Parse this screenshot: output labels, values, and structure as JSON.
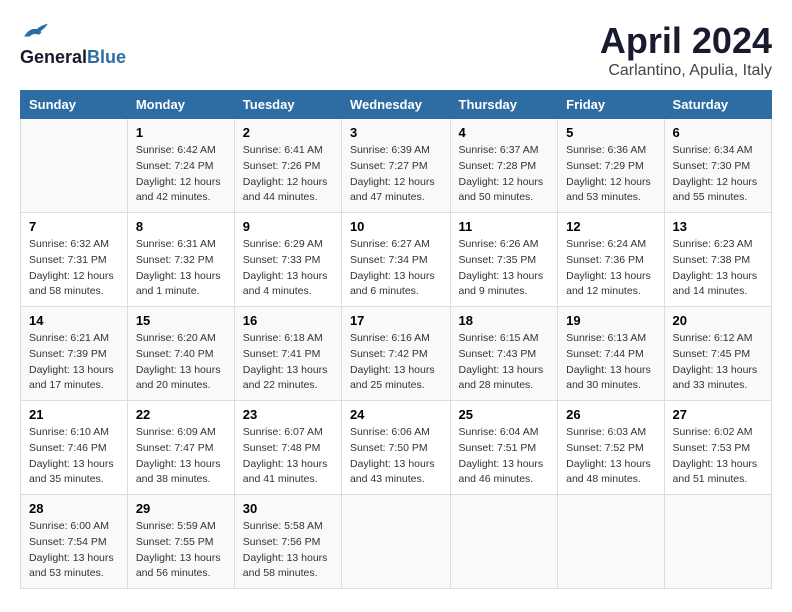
{
  "header": {
    "logo_general": "General",
    "logo_blue": "Blue",
    "month_title": "April 2024",
    "location": "Carlantino, Apulia, Italy"
  },
  "days_of_week": [
    "Sunday",
    "Monday",
    "Tuesday",
    "Wednesday",
    "Thursday",
    "Friday",
    "Saturday"
  ],
  "weeks": [
    [
      {
        "day": "",
        "sunrise": "",
        "sunset": "",
        "daylight": ""
      },
      {
        "day": "1",
        "sunrise": "Sunrise: 6:42 AM",
        "sunset": "Sunset: 7:24 PM",
        "daylight": "Daylight: 12 hours and 42 minutes."
      },
      {
        "day": "2",
        "sunrise": "Sunrise: 6:41 AM",
        "sunset": "Sunset: 7:26 PM",
        "daylight": "Daylight: 12 hours and 44 minutes."
      },
      {
        "day": "3",
        "sunrise": "Sunrise: 6:39 AM",
        "sunset": "Sunset: 7:27 PM",
        "daylight": "Daylight: 12 hours and 47 minutes."
      },
      {
        "day": "4",
        "sunrise": "Sunrise: 6:37 AM",
        "sunset": "Sunset: 7:28 PM",
        "daylight": "Daylight: 12 hours and 50 minutes."
      },
      {
        "day": "5",
        "sunrise": "Sunrise: 6:36 AM",
        "sunset": "Sunset: 7:29 PM",
        "daylight": "Daylight: 12 hours and 53 minutes."
      },
      {
        "day": "6",
        "sunrise": "Sunrise: 6:34 AM",
        "sunset": "Sunset: 7:30 PM",
        "daylight": "Daylight: 12 hours and 55 minutes."
      }
    ],
    [
      {
        "day": "7",
        "sunrise": "Sunrise: 6:32 AM",
        "sunset": "Sunset: 7:31 PM",
        "daylight": "Daylight: 12 hours and 58 minutes."
      },
      {
        "day": "8",
        "sunrise": "Sunrise: 6:31 AM",
        "sunset": "Sunset: 7:32 PM",
        "daylight": "Daylight: 13 hours and 1 minute."
      },
      {
        "day": "9",
        "sunrise": "Sunrise: 6:29 AM",
        "sunset": "Sunset: 7:33 PM",
        "daylight": "Daylight: 13 hours and 4 minutes."
      },
      {
        "day": "10",
        "sunrise": "Sunrise: 6:27 AM",
        "sunset": "Sunset: 7:34 PM",
        "daylight": "Daylight: 13 hours and 6 minutes."
      },
      {
        "day": "11",
        "sunrise": "Sunrise: 6:26 AM",
        "sunset": "Sunset: 7:35 PM",
        "daylight": "Daylight: 13 hours and 9 minutes."
      },
      {
        "day": "12",
        "sunrise": "Sunrise: 6:24 AM",
        "sunset": "Sunset: 7:36 PM",
        "daylight": "Daylight: 13 hours and 12 minutes."
      },
      {
        "day": "13",
        "sunrise": "Sunrise: 6:23 AM",
        "sunset": "Sunset: 7:38 PM",
        "daylight": "Daylight: 13 hours and 14 minutes."
      }
    ],
    [
      {
        "day": "14",
        "sunrise": "Sunrise: 6:21 AM",
        "sunset": "Sunset: 7:39 PM",
        "daylight": "Daylight: 13 hours and 17 minutes."
      },
      {
        "day": "15",
        "sunrise": "Sunrise: 6:20 AM",
        "sunset": "Sunset: 7:40 PM",
        "daylight": "Daylight: 13 hours and 20 minutes."
      },
      {
        "day": "16",
        "sunrise": "Sunrise: 6:18 AM",
        "sunset": "Sunset: 7:41 PM",
        "daylight": "Daylight: 13 hours and 22 minutes."
      },
      {
        "day": "17",
        "sunrise": "Sunrise: 6:16 AM",
        "sunset": "Sunset: 7:42 PM",
        "daylight": "Daylight: 13 hours and 25 minutes."
      },
      {
        "day": "18",
        "sunrise": "Sunrise: 6:15 AM",
        "sunset": "Sunset: 7:43 PM",
        "daylight": "Daylight: 13 hours and 28 minutes."
      },
      {
        "day": "19",
        "sunrise": "Sunrise: 6:13 AM",
        "sunset": "Sunset: 7:44 PM",
        "daylight": "Daylight: 13 hours and 30 minutes."
      },
      {
        "day": "20",
        "sunrise": "Sunrise: 6:12 AM",
        "sunset": "Sunset: 7:45 PM",
        "daylight": "Daylight: 13 hours and 33 minutes."
      }
    ],
    [
      {
        "day": "21",
        "sunrise": "Sunrise: 6:10 AM",
        "sunset": "Sunset: 7:46 PM",
        "daylight": "Daylight: 13 hours and 35 minutes."
      },
      {
        "day": "22",
        "sunrise": "Sunrise: 6:09 AM",
        "sunset": "Sunset: 7:47 PM",
        "daylight": "Daylight: 13 hours and 38 minutes."
      },
      {
        "day": "23",
        "sunrise": "Sunrise: 6:07 AM",
        "sunset": "Sunset: 7:48 PM",
        "daylight": "Daylight: 13 hours and 41 minutes."
      },
      {
        "day": "24",
        "sunrise": "Sunrise: 6:06 AM",
        "sunset": "Sunset: 7:50 PM",
        "daylight": "Daylight: 13 hours and 43 minutes."
      },
      {
        "day": "25",
        "sunrise": "Sunrise: 6:04 AM",
        "sunset": "Sunset: 7:51 PM",
        "daylight": "Daylight: 13 hours and 46 minutes."
      },
      {
        "day": "26",
        "sunrise": "Sunrise: 6:03 AM",
        "sunset": "Sunset: 7:52 PM",
        "daylight": "Daylight: 13 hours and 48 minutes."
      },
      {
        "day": "27",
        "sunrise": "Sunrise: 6:02 AM",
        "sunset": "Sunset: 7:53 PM",
        "daylight": "Daylight: 13 hours and 51 minutes."
      }
    ],
    [
      {
        "day": "28",
        "sunrise": "Sunrise: 6:00 AM",
        "sunset": "Sunset: 7:54 PM",
        "daylight": "Daylight: 13 hours and 53 minutes."
      },
      {
        "day": "29",
        "sunrise": "Sunrise: 5:59 AM",
        "sunset": "Sunset: 7:55 PM",
        "daylight": "Daylight: 13 hours and 56 minutes."
      },
      {
        "day": "30",
        "sunrise": "Sunrise: 5:58 AM",
        "sunset": "Sunset: 7:56 PM",
        "daylight": "Daylight: 13 hours and 58 minutes."
      },
      {
        "day": "",
        "sunrise": "",
        "sunset": "",
        "daylight": ""
      },
      {
        "day": "",
        "sunrise": "",
        "sunset": "",
        "daylight": ""
      },
      {
        "day": "",
        "sunrise": "",
        "sunset": "",
        "daylight": ""
      },
      {
        "day": "",
        "sunrise": "",
        "sunset": "",
        "daylight": ""
      }
    ]
  ]
}
